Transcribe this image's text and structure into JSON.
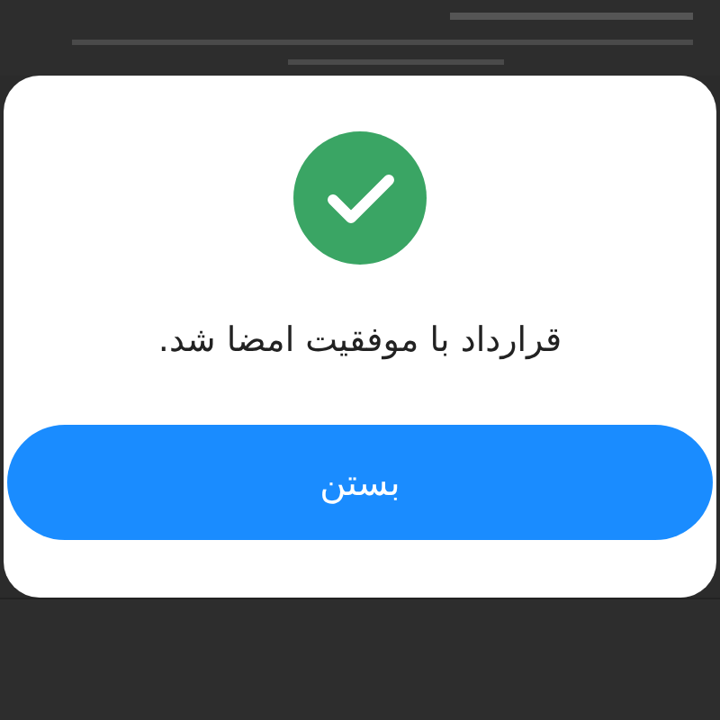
{
  "dialog": {
    "message": "قرارداد با موفقیت امضا شد.",
    "button": "بستن"
  }
}
